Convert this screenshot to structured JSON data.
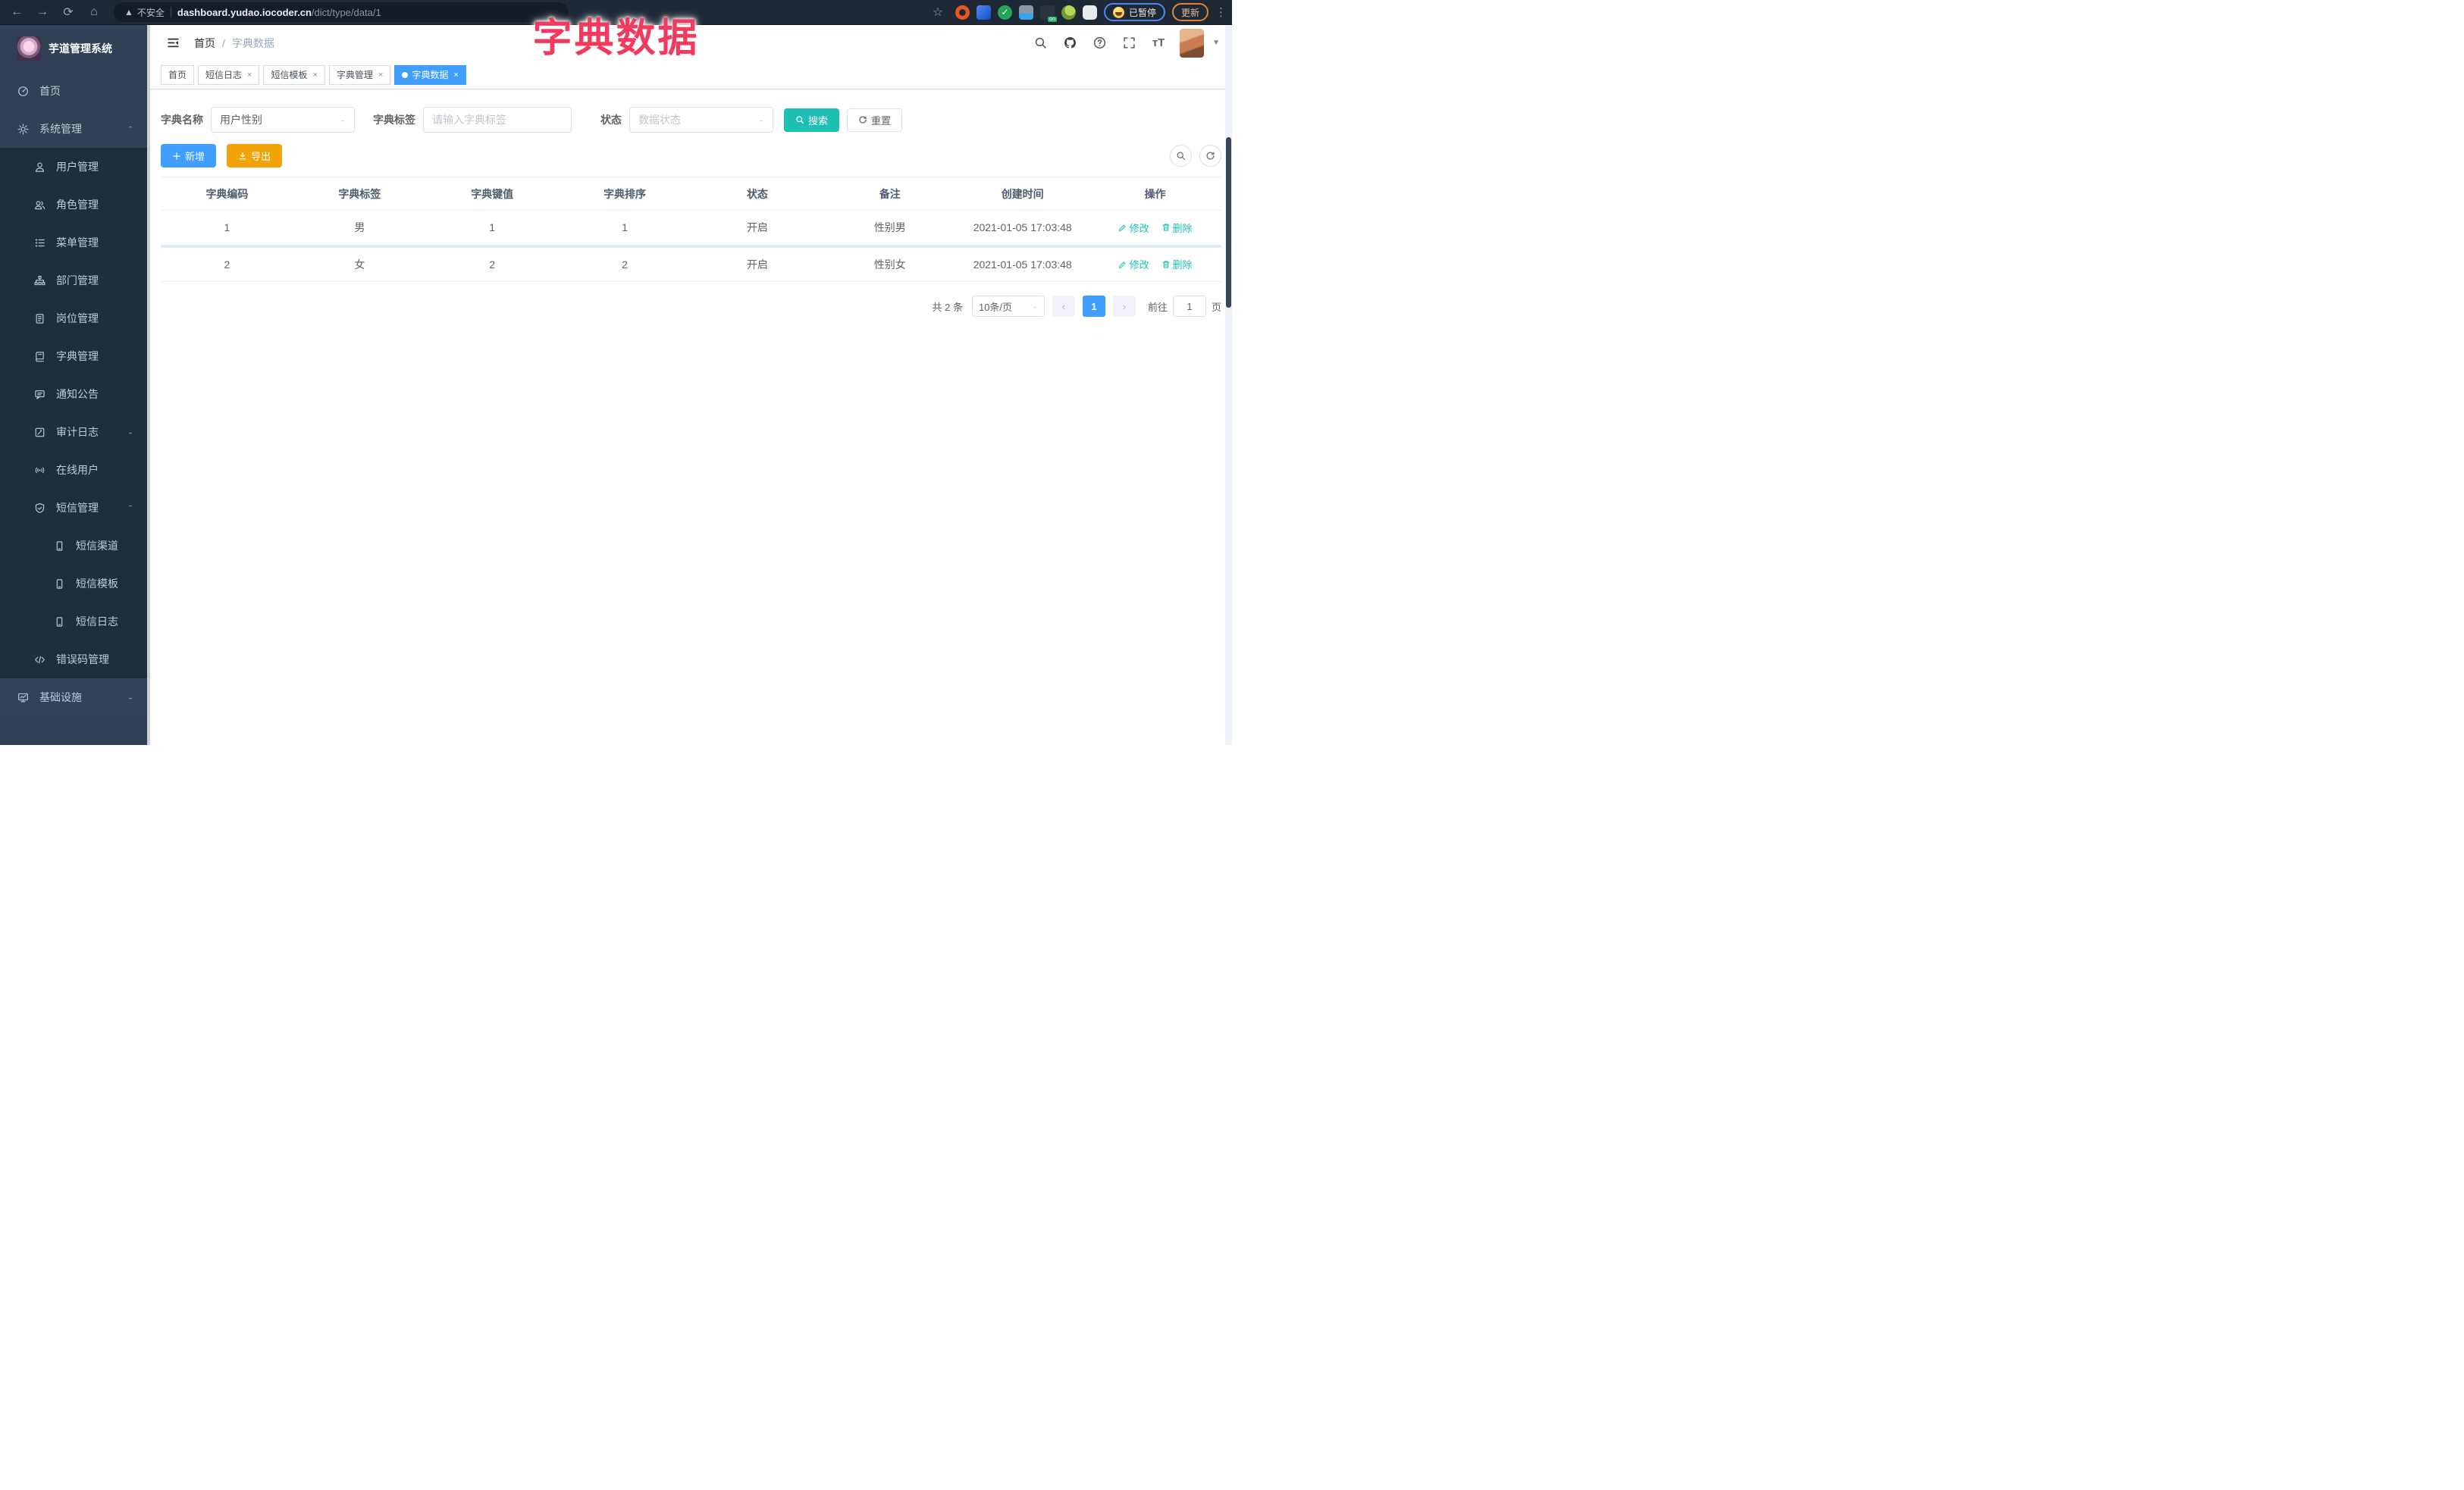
{
  "browser": {
    "security_label": "不安全",
    "url_host": "dashboard.yudao.iocoder.cn",
    "url_path": "/dict/type/data/1",
    "paused_label": "已暂停",
    "update_label": "更新"
  },
  "overlay_title": "字典数据",
  "sidebar": {
    "title": "芋道管理系统",
    "items": [
      {
        "label": "首页",
        "icon": "dashboard-icon",
        "level": 1
      },
      {
        "label": "系统管理",
        "icon": "gear-icon",
        "level": 1,
        "chevron": "up"
      },
      {
        "label": "用户管理",
        "icon": "user-icon",
        "level": 2
      },
      {
        "label": "角色管理",
        "icon": "users-icon",
        "level": 2
      },
      {
        "label": "菜单管理",
        "icon": "menu-list-icon",
        "level": 2
      },
      {
        "label": "部门管理",
        "icon": "org-tree-icon",
        "level": 2
      },
      {
        "label": "岗位管理",
        "icon": "badge-icon",
        "level": 2
      },
      {
        "label": "字典管理",
        "icon": "dictionary-icon",
        "level": 2
      },
      {
        "label": "通知公告",
        "icon": "announcement-icon",
        "level": 2
      },
      {
        "label": "审计日志",
        "icon": "audit-log-icon",
        "level": 2,
        "chevron": "down"
      },
      {
        "label": "在线用户",
        "icon": "online-user-icon",
        "level": 2
      },
      {
        "label": "短信管理",
        "icon": "sms-shield-icon",
        "level": 2,
        "chevron": "up"
      },
      {
        "label": "短信渠道",
        "icon": "phone-icon",
        "level": 3
      },
      {
        "label": "短信模板",
        "icon": "phone-icon",
        "level": 3
      },
      {
        "label": "短信日志",
        "icon": "phone-icon",
        "level": 3
      },
      {
        "label": "错误码管理",
        "icon": "code-icon",
        "level": 2
      },
      {
        "label": "基础设施",
        "icon": "monitor-icon",
        "level": 1,
        "chevron": "down"
      }
    ]
  },
  "header": {
    "breadcrumb_home": "首页",
    "breadcrumb_sep": "/",
    "breadcrumb_current": "字典数据"
  },
  "tabs": [
    {
      "label": "首页"
    },
    {
      "label": "短信日志",
      "close": "×"
    },
    {
      "label": "短信模板",
      "close": "×"
    },
    {
      "label": "字典管理",
      "close": "×"
    },
    {
      "label": "字典数据",
      "close": "×",
      "active": true
    }
  ],
  "filters": {
    "dict_name_label": "字典名称",
    "dict_name_value": "用户性别",
    "dict_label_label": "字典标签",
    "dict_label_placeholder": "请输入字典标签",
    "status_label": "状态",
    "status_placeholder": "数据状态",
    "search_label": "搜索",
    "reset_label": "重置"
  },
  "toolbar": {
    "add_label": "新增",
    "export_label": "导出"
  },
  "table": {
    "columns": [
      "字典编码",
      "字典标签",
      "字典键值",
      "字典排序",
      "状态",
      "备注",
      "创建时间",
      "操作"
    ],
    "rows": [
      {
        "code": "1",
        "label": "男",
        "value": "1",
        "sort": "1",
        "status": "开启",
        "remark": "性别男",
        "created": "2021-01-05 17:03:48"
      },
      {
        "code": "2",
        "label": "女",
        "value": "2",
        "sort": "2",
        "status": "开启",
        "remark": "性别女",
        "created": "2021-01-05 17:03:48"
      }
    ],
    "edit_label": "修改",
    "delete_label": "删除"
  },
  "pagination": {
    "total": "共 2 条",
    "page_size": "10条/页",
    "prev": "‹",
    "next": "›",
    "current_page": "1",
    "goto_label": "前往",
    "goto_value": "1",
    "page_unit": "页"
  },
  "colors": {
    "accent_blue": "#409eff",
    "teal": "#1dbfb4",
    "warning_orange": "#f3a30a",
    "overlay_pink": "#f23a5f",
    "sidebar_bg": "#304156",
    "submenu_bg": "#1f2d3d"
  }
}
